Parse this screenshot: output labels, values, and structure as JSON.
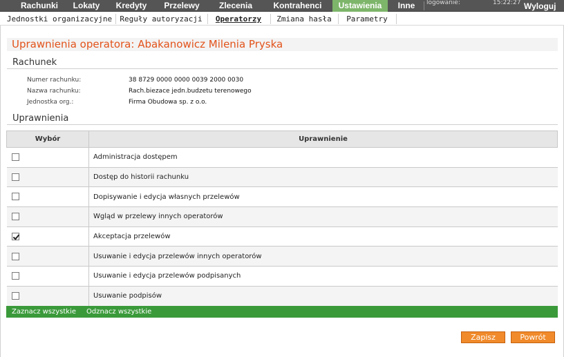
{
  "topnav": {
    "tabs": [
      {
        "label": "Rachunki"
      },
      {
        "label": "Lokaty"
      },
      {
        "label": "Kredyty"
      },
      {
        "label": "Przelewy"
      },
      {
        "label": "Zlecenia"
      },
      {
        "label": "Kontrahenci"
      },
      {
        "label": "Ustawienia"
      },
      {
        "label": "Inne"
      }
    ],
    "active_tab": "Ustawienia",
    "login_label": "logowanie:",
    "clock": "15:22:27",
    "logout_label": "Wyloguj",
    "active_color": "#7db56a"
  },
  "subnav": {
    "items": [
      {
        "label": "Jednostki organizacyjne"
      },
      {
        "label": "Reguły autoryzacji"
      },
      {
        "label": "Operatorzy"
      },
      {
        "label": "Zmiana hasła"
      },
      {
        "label": "Parametry"
      }
    ],
    "active_item": "Operatorzy"
  },
  "page": {
    "title": "Uprawnienia operatora: Abakanowicz Milenia Pryska",
    "title_color": "#e2531b"
  },
  "account": {
    "section_title": "Rachunek",
    "fields": [
      {
        "label": "Numer rachunku:",
        "value": "38 8729 0000 0000 0039 2000 0030"
      },
      {
        "label": "Nazwa rachunku:",
        "value": "Rach.biezace jedn.budzetu terenowego"
      },
      {
        "label": "Jednostka org.:",
        "value": "Firma Obudowa sp. z o.o."
      }
    ]
  },
  "permissions": {
    "section_title": "Uprawnienia",
    "col_select": "Wybór",
    "col_permission": "Uprawnienie",
    "rows": [
      {
        "label": "Administracja dostępem",
        "checked": false
      },
      {
        "label": "Dostęp do historii rachunku",
        "checked": false
      },
      {
        "label": "Dopisywanie i edycja własnych przelewów",
        "checked": false
      },
      {
        "label": "Wgląd w przelewy innych operatorów",
        "checked": false
      },
      {
        "label": "Akceptacja przelewów",
        "checked": true
      },
      {
        "label": "Usuwanie i edycja przelewów innych operatorów",
        "checked": false
      },
      {
        "label": "Usuwanie i edycja przelewów podpisanych",
        "checked": false
      },
      {
        "label": "Usuwanie podpisów",
        "checked": false
      }
    ],
    "select_all": "Zaznacz wszystkie",
    "deselect_all": "Odznacz wszystkie",
    "bar_color": "#3a9a3a"
  },
  "actions": {
    "save": "Zapisz",
    "back": "Powrót",
    "button_color": "#f08a2b"
  }
}
